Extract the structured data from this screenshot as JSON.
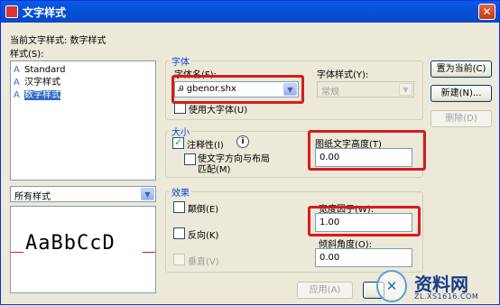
{
  "window": {
    "title": "文字样式"
  },
  "left": {
    "current_style_label": "当前文字样式:  数字样式",
    "styles_label": "样式(S):",
    "styles": [
      {
        "name": "Standard",
        "selected": false
      },
      {
        "name": "汉字样式",
        "selected": false
      },
      {
        "name": "数字样式",
        "selected": true
      }
    ],
    "filter_value": "所有样式",
    "preview_text": "AaBbCcD"
  },
  "font": {
    "group_title": "字体",
    "font_name_label": "字体名(F):",
    "font_name_value": "gbenor.shx",
    "font_style_label": "字体样式(Y):",
    "font_style_value": "常规",
    "big_font_label": "使用大字体(U)"
  },
  "size": {
    "group_title": "大小",
    "annotative_label": "注释性(I)",
    "annotative_checked": true,
    "match_orientation_label_1": "使文字方向与布局",
    "match_orientation_label_2": "匹配(M)",
    "paper_height_label": "图纸文字高度(T)",
    "paper_height_value": "0.00"
  },
  "effects": {
    "group_title": "效果",
    "upside_down_label": "颠倒(E)",
    "backwards_label": "反向(K)",
    "vertical_label": "垂直(V)",
    "width_factor_label": "宽度因子(W):",
    "width_factor_value": "1.00",
    "oblique_label": "倾斜角度(O):",
    "oblique_value": "0.00"
  },
  "buttons": {
    "set_current": "置为当前(C)",
    "new": "新建(N)...",
    "delete": "删除(D)",
    "apply": "应用(A)"
  },
  "watermark": {
    "title": "资料网",
    "url": "ZL.XS1616.COM"
  },
  "colors": {
    "titlebar": "#0453d8",
    "highlight": "#d61c1c",
    "selection": "#316ac5"
  }
}
